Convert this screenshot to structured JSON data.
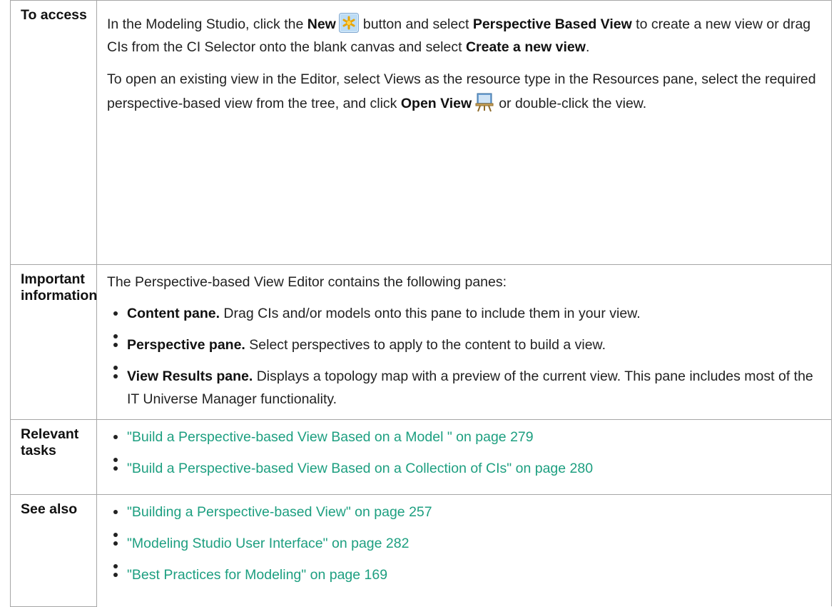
{
  "rows": {
    "access": {
      "label": "To access",
      "p1": {
        "t1": "In the Modeling Studio, click the",
        "b1": "New",
        "t2": "button and select",
        "b2": "Perspective Based View",
        "t3": "to create a new view or drag CIs from the CI Selector onto the blank canvas and select",
        "b3": "Create a new view",
        "t4": "."
      },
      "p2": {
        "t1": "To open an existing view in the Editor, select Views as the resource type in the Resources pane, select the required perspective-based view from the tree, and click",
        "b1": "Open View",
        "t2": "or double-click the view."
      },
      "icons": [
        "new-asterisk-icon",
        "open-view-icon"
      ]
    },
    "important": {
      "label": "Important information",
      "intro": "The Perspective-based View Editor contains the following panes:",
      "items": [
        {
          "bold": "Content pane.",
          "text": "Drag CIs and/or models onto this pane to include them in your view."
        },
        {
          "bold": "Perspective pane.",
          "text": "Select perspectives to apply to the content to build a view."
        },
        {
          "bold": "View Results pane.",
          "text": "Displays a topology map with a preview of the current view. This pane includes most of the IT Universe Manager functionality."
        }
      ]
    },
    "relevant": {
      "label": "Relevant tasks",
      "links": [
        "\"Build a Perspective-based View Based on a Model \" on page 279",
        "\"Build a Perspective-based View Based on a Collection of CIs\" on page 280"
      ]
    },
    "seealso": {
      "label": "See also",
      "links": [
        "\"Building a Perspective-based View\" on page 257",
        "\"Modeling Studio User Interface\" on page 282",
        "\"Best Practices for Modeling\" on page 169"
      ]
    }
  },
  "colors": {
    "link": "#1d9f80",
    "border": "#a6a6a6",
    "text": "#222222"
  }
}
